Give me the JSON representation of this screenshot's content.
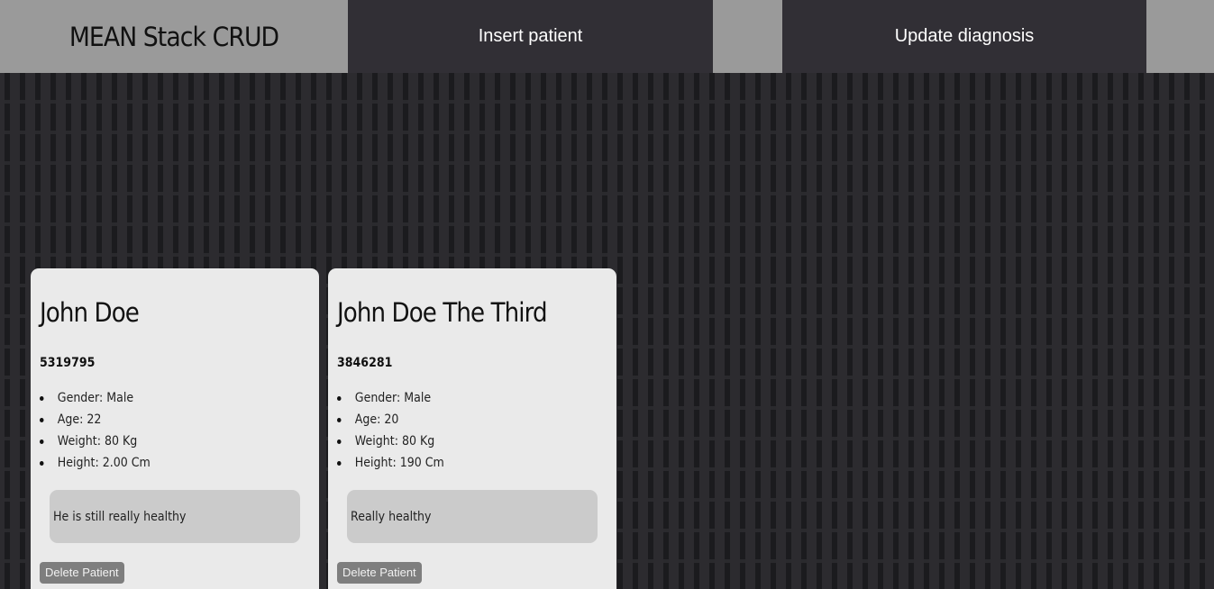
{
  "navbar": {
    "brand": "MEAN Stack CRUD",
    "insert_label": "Insert patient",
    "update_label": "Update diagnosis"
  },
  "patients": [
    {
      "name": "John Doe",
      "id": "5319795",
      "details": [
        "Gender: Male",
        "Age: 22",
        "Weight: 80 Kg",
        "Height: 2.00 Cm"
      ],
      "diagnosis": "He is still really healthy",
      "delete_label": "Delete Patient"
    },
    {
      "name": "John Doe The Third",
      "id": "3846281",
      "details": [
        "Gender: Male",
        "Age: 20",
        "Weight: 80 Kg",
        "Height: 190 Cm"
      ],
      "diagnosis": "Really healthy",
      "delete_label": "Delete Patient"
    }
  ]
}
